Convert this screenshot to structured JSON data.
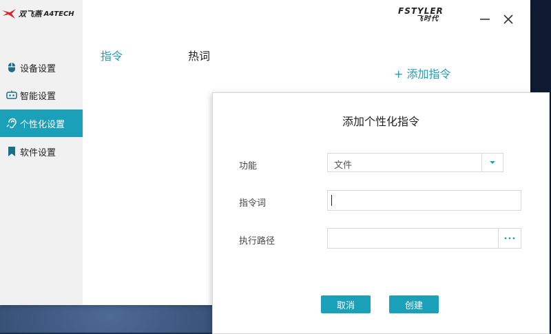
{
  "brand": {
    "name": "双飞燕",
    "sub": "A4TECH"
  },
  "titlebar": {
    "logo_line1": "FSTYLER",
    "logo_line2": "飞时代"
  },
  "sidebar": {
    "items": [
      {
        "label": "设备设置",
        "icon": "mouse-icon"
      },
      {
        "label": "智能设置",
        "icon": "smart-icon"
      },
      {
        "label": "个性化设置",
        "icon": "hearing-icon",
        "active": true
      },
      {
        "label": "软件设置",
        "icon": "bookmark-icon"
      }
    ]
  },
  "tabs": [
    {
      "label": "指令",
      "active": true
    },
    {
      "label": "热词"
    }
  ],
  "main": {
    "add_label": "+ 添加指令"
  },
  "dialog": {
    "title": "添加个性化指令",
    "function_label": "功能",
    "function_value": "文件",
    "keyword_label": "指令词",
    "keyword_value": "",
    "path_label": "执行路径",
    "path_value": "",
    "browse_label": "···",
    "cancel_label": "取消",
    "create_label": "创建"
  },
  "colors": {
    "accent": "#1aa0b8",
    "sidebar_bg": "#f1f1f1"
  }
}
